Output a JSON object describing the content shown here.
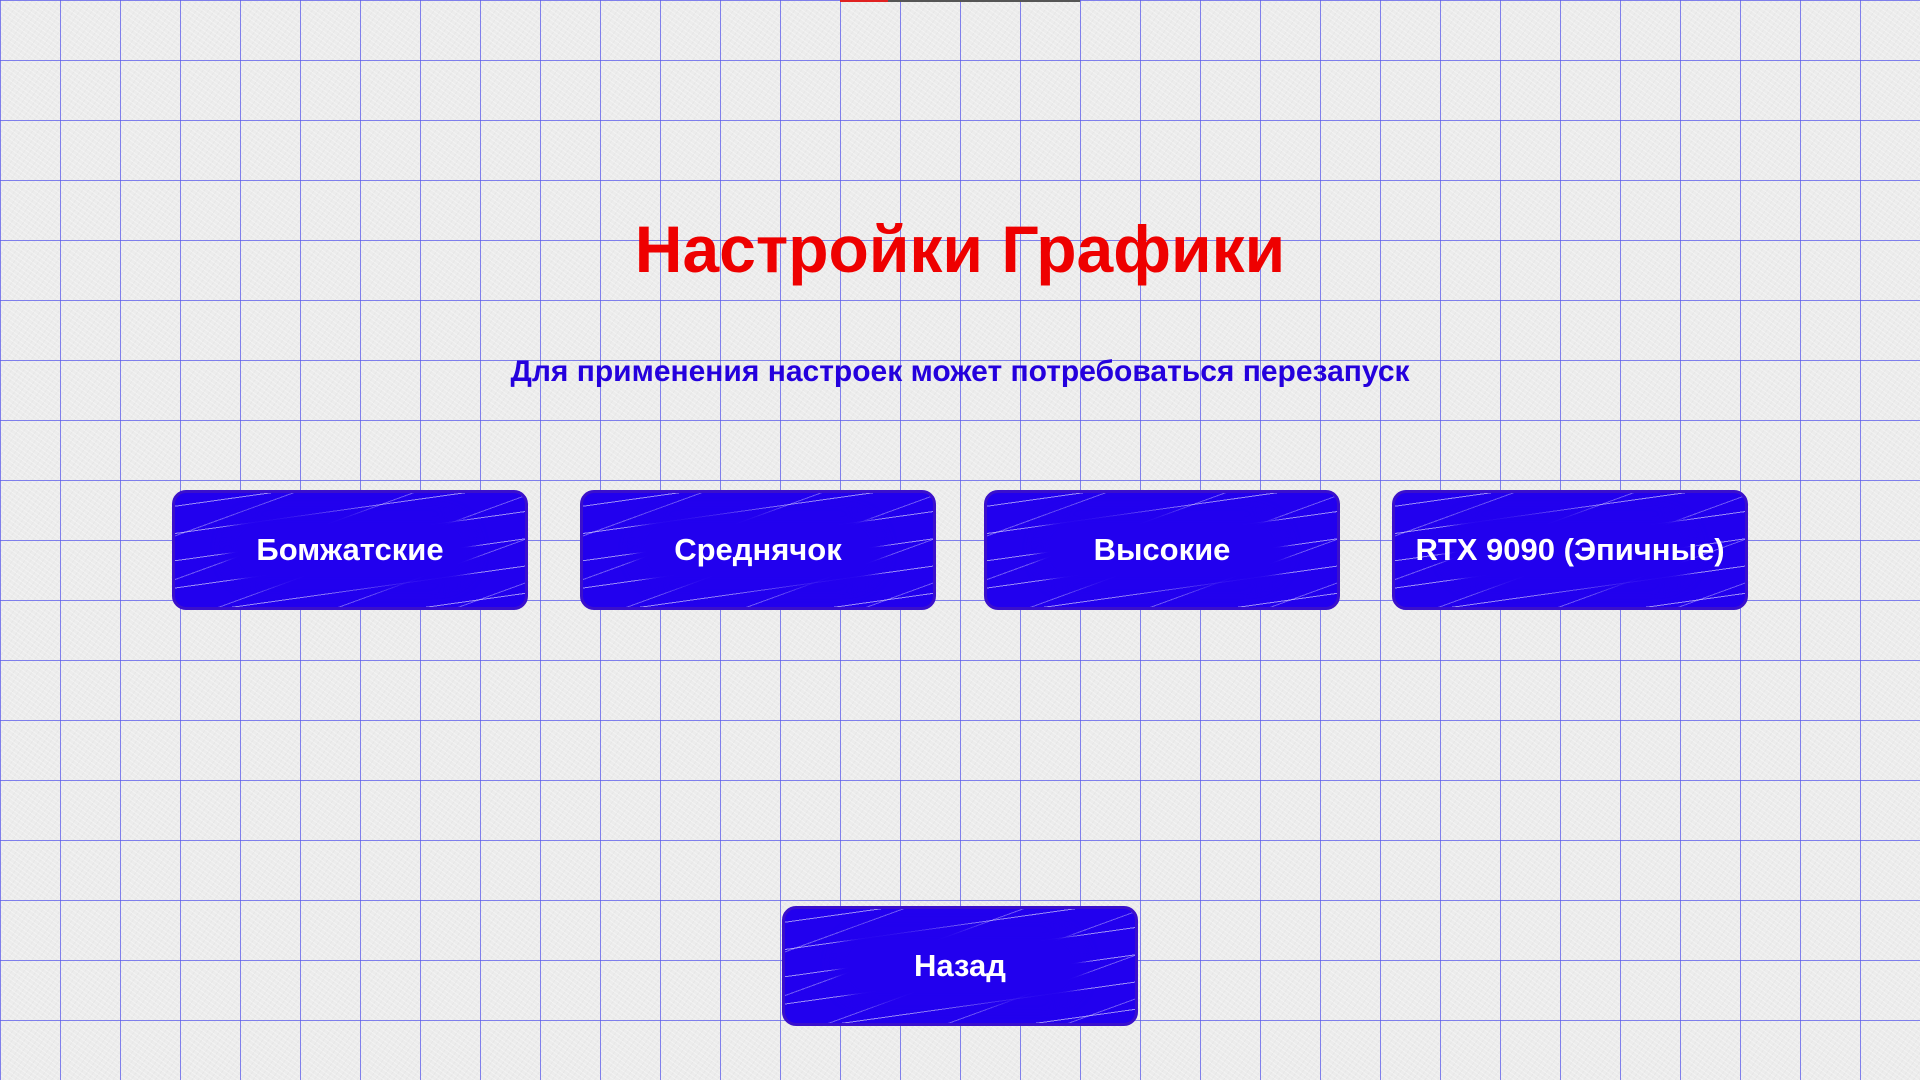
{
  "colors": {
    "title": "#ee0000",
    "subtitle": "#2400dd",
    "button_fill": "#2200ee",
    "button_text": "#ffffff",
    "grid_line": "#5a5aeb",
    "paper": "#ececec"
  },
  "header": {
    "title": "Настройки Графики",
    "subtitle": "Для применения настроек может потребоваться перезапуск"
  },
  "quality_options": [
    {
      "label": "Бомжатские"
    },
    {
      "label": "Среднячок"
    },
    {
      "label": "Высокие"
    },
    {
      "label": "RTX 9090 (Эпичные)"
    }
  ],
  "footer": {
    "back_label": "Назад"
  }
}
